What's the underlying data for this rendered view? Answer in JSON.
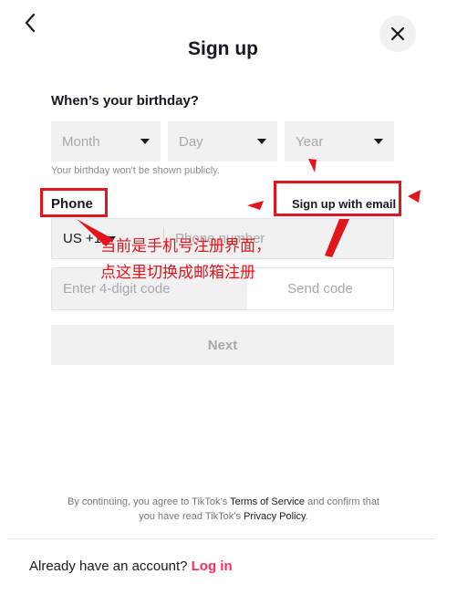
{
  "header": {
    "title": "Sign up"
  },
  "birthday": {
    "label": "When’s your birthday?",
    "month_placeholder": "Month",
    "day_placeholder": "Day",
    "year_placeholder": "Year",
    "hint": "Your birthday won't be shown publicly."
  },
  "phone_section": {
    "label": "Phone",
    "switch_label": "Sign up with email",
    "country_code": "US +1",
    "phone_placeholder": "Phone number",
    "code_placeholder": "Enter 4-digit code",
    "send_code_label": "Send code",
    "next_label": "Next"
  },
  "terms": {
    "prefix": "By continuing, you agree to TikTok’s ",
    "terms_link": "Terms of Service",
    "middle": " and confirm that",
    "line2_prefix": "you have read TikTok’s ",
    "privacy_link": "Privacy Policy",
    "suffix": "."
  },
  "footer": {
    "question": "Already have an account?",
    "login_label": "Log in"
  },
  "annotation": {
    "line1": "当前是手机号注册界面，",
    "line2": "点这里切换成邮箱注册"
  },
  "colors": {
    "accent": "#fe2c55",
    "annotation": "#e3141c",
    "field_bg": "#f1f1f2"
  },
  "icons": {
    "back": "chevron-left-icon",
    "close": "close-icon",
    "dropdown": "caret-down-icon"
  }
}
